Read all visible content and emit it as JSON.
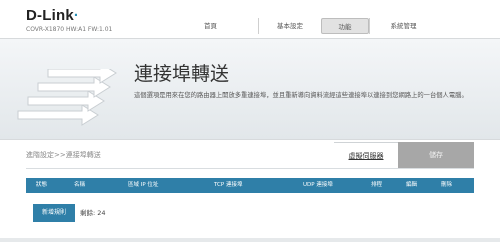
{
  "header": {
    "logo": "D-Link",
    "model": "COVR-X1870 HW:A1 FW:1.01"
  },
  "nav": {
    "items": [
      {
        "label": "首頁"
      },
      {
        "label": "基本設定"
      },
      {
        "label": "功能",
        "active": true
      },
      {
        "label": "系統管理"
      }
    ]
  },
  "banner": {
    "title": "連接埠轉送",
    "description": "這個選項是用來在您的路由器上開放多重連接埠，並且重新導向資料流經這些連接埠以連接到您網路上的一台個人電腦。"
  },
  "breadcrumb": "進階設定>>連接埠轉送",
  "toolbar": {
    "server_link": "虛擬伺服器",
    "save_label": "儲存"
  },
  "table": {
    "columns": [
      "狀態",
      "名稱",
      "區域 IP 位址",
      "TCP 連接埠",
      "UDP 連接埠",
      "排程",
      "編輯",
      "刪除"
    ]
  },
  "footer": {
    "add_rule_label": "新增規則",
    "remaining_label": "剩餘: 24"
  },
  "colors": {
    "accent": "#2f7fa8",
    "save_disabled": "#a7a7a7"
  }
}
